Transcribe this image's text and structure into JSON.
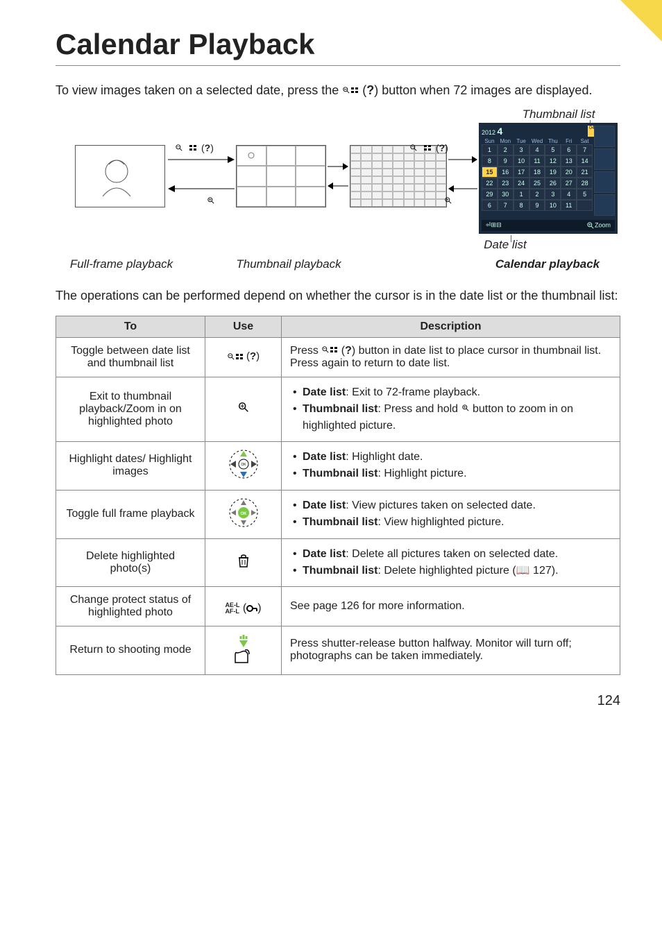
{
  "title": "Calendar Playback",
  "intro_parts": {
    "a": "To view images taken on a selected date, press the ",
    "b": " (",
    "help": "?",
    "c": ") button when 72 images are displayed."
  },
  "diagram": {
    "thumbnail_list_label": "Thumbnail list",
    "date_list_label": "Date list",
    "full_frame_label": "Full-frame playback",
    "thumbnail_playback_label": "Thumbnail playback",
    "calendar_playback_label": "Calendar playback",
    "calendar": {
      "year": "2012",
      "month": "4",
      "badge": "04/15/2012",
      "days": [
        "Sun",
        "Mon",
        "Tue",
        "Wed",
        "Thu",
        "Fri",
        "Sat"
      ],
      "rows": [
        [
          "1",
          "2",
          "3",
          "4",
          "5",
          "6",
          "7"
        ],
        [
          "8",
          "9",
          "10",
          "11",
          "12",
          "13",
          "14"
        ],
        [
          "15",
          "16",
          "17",
          "18",
          "19",
          "20",
          "21"
        ],
        [
          "22",
          "23",
          "24",
          "25",
          "26",
          "27",
          "28"
        ],
        [
          "29",
          "30",
          "1",
          "2",
          "3",
          "4",
          "5"
        ],
        [
          "6",
          "7",
          "8",
          "9",
          "10",
          "11",
          ""
        ]
      ],
      "foot_left": "⏎⊞⊟",
      "foot_right": "Zoom"
    }
  },
  "para2": "The operations can be performed depend on whether the cursor is in the date list or the thumbnail list:",
  "table": {
    "headers": [
      "To",
      "Use",
      "Description"
    ],
    "rows": [
      {
        "to": "Toggle between date list and thumbnail list",
        "use_type": "zoomout_help",
        "desc_plain_parts": {
          "a": "Press ",
          "b": " (",
          "help": "?",
          "c": ") button in date list to place cursor in thumbnail list.  Press again to return to date list."
        }
      },
      {
        "to": "Exit to thumbnail playback/Zoom in on highlighted photo",
        "use_type": "zoomin",
        "desc_list": [
          {
            "bold": "Date list",
            "rest": ": Exit to 72-frame playback."
          },
          {
            "bold": "Thumbnail list",
            "rest_parts": {
              "a": ": Press and hold ",
              "b": " button to zoom in on highlighted picture."
            }
          }
        ]
      },
      {
        "to": "Highlight dates/ Highlight images",
        "use_type": "dpad4",
        "desc_list": [
          {
            "bold": "Date list",
            "rest": ": Highlight date."
          },
          {
            "bold": "Thumbnail list",
            "rest": ": Highlight picture."
          }
        ]
      },
      {
        "to": "Toggle full frame playback",
        "use_type": "dpad_ok",
        "desc_list": [
          {
            "bold": "Date list",
            "rest": ": View pictures taken on selected date."
          },
          {
            "bold": "Thumbnail list",
            "rest": ": View highlighted picture."
          }
        ]
      },
      {
        "to": "Delete highlighted photo(s)",
        "use_type": "trash",
        "desc_list": [
          {
            "bold": "Date list",
            "rest": ": Delete all pictures taken on selected date."
          },
          {
            "bold": "Thumbnail list",
            "rest": ": Delete highlighted picture (📖 127)."
          }
        ]
      },
      {
        "to": "Change protect status of highlighted photo",
        "use_type": "ael_lock",
        "use_label_a": "AE-L",
        "use_label_b": "AF-L",
        "desc_plain": "See page 126 for more information."
      },
      {
        "to": "Return to shooting mode",
        "use_type": "shutter",
        "desc_plain": "Press shutter-release button halfway.  Monitor will turn off; photographs can be taken immediately."
      }
    ]
  },
  "page_number": "124"
}
